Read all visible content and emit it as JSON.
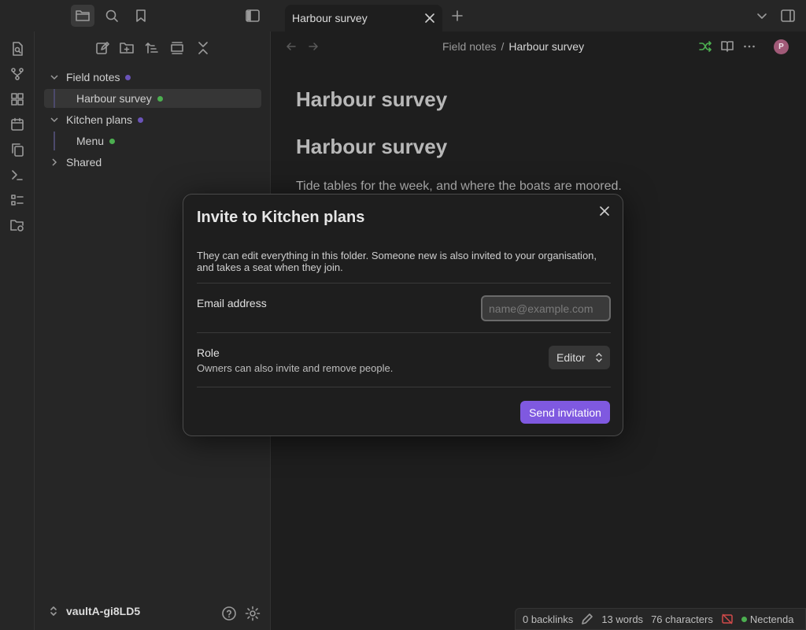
{
  "tab": {
    "title": "Harbour survey"
  },
  "sidebar": {
    "tree": [
      {
        "label": "Field notes",
        "dot": "#6a53b8"
      },
      {
        "label": "Harbour survey",
        "dot": "#4caf50"
      },
      {
        "label": "Kitchen plans",
        "dot": "#6a53b8"
      },
      {
        "label": "Menu",
        "dot": "#4caf50"
      },
      {
        "label": "Shared"
      }
    ],
    "vault_name": "vaultA-gi8LD5"
  },
  "editor": {
    "breadcrumb_parent": "Field notes",
    "breadcrumb_sep": "/",
    "breadcrumb_current": "Harbour survey",
    "inline_title": "Harbour survey",
    "heading": "Harbour survey",
    "body": "Tide tables for the week, and where the boats are moored.",
    "avatar_initial": "P"
  },
  "modal": {
    "title": "Invite to Kitchen plans",
    "description": "They can edit everything in this folder. Someone new is also invited to your organisation, and takes a seat when they join.",
    "email_label": "Email address",
    "email_placeholder": "name@example.com",
    "email_value": "",
    "role_label": "Role",
    "role_help": "Owners can also invite and remove people.",
    "role_value": "Editor",
    "submit_label": "Send invitation"
  },
  "statusbar": {
    "backlinks": "0 backlinks",
    "words": "13 words",
    "characters": "76 characters",
    "sync_user": "Nectenda",
    "sync_dot": "#4caf50"
  },
  "colors": {
    "accent": "#7f59e0",
    "folder_dot": "#6a53b8",
    "file_dot": "#4caf50",
    "graph_green": "#4caf50",
    "sync_off_red": "#d14a4a"
  }
}
